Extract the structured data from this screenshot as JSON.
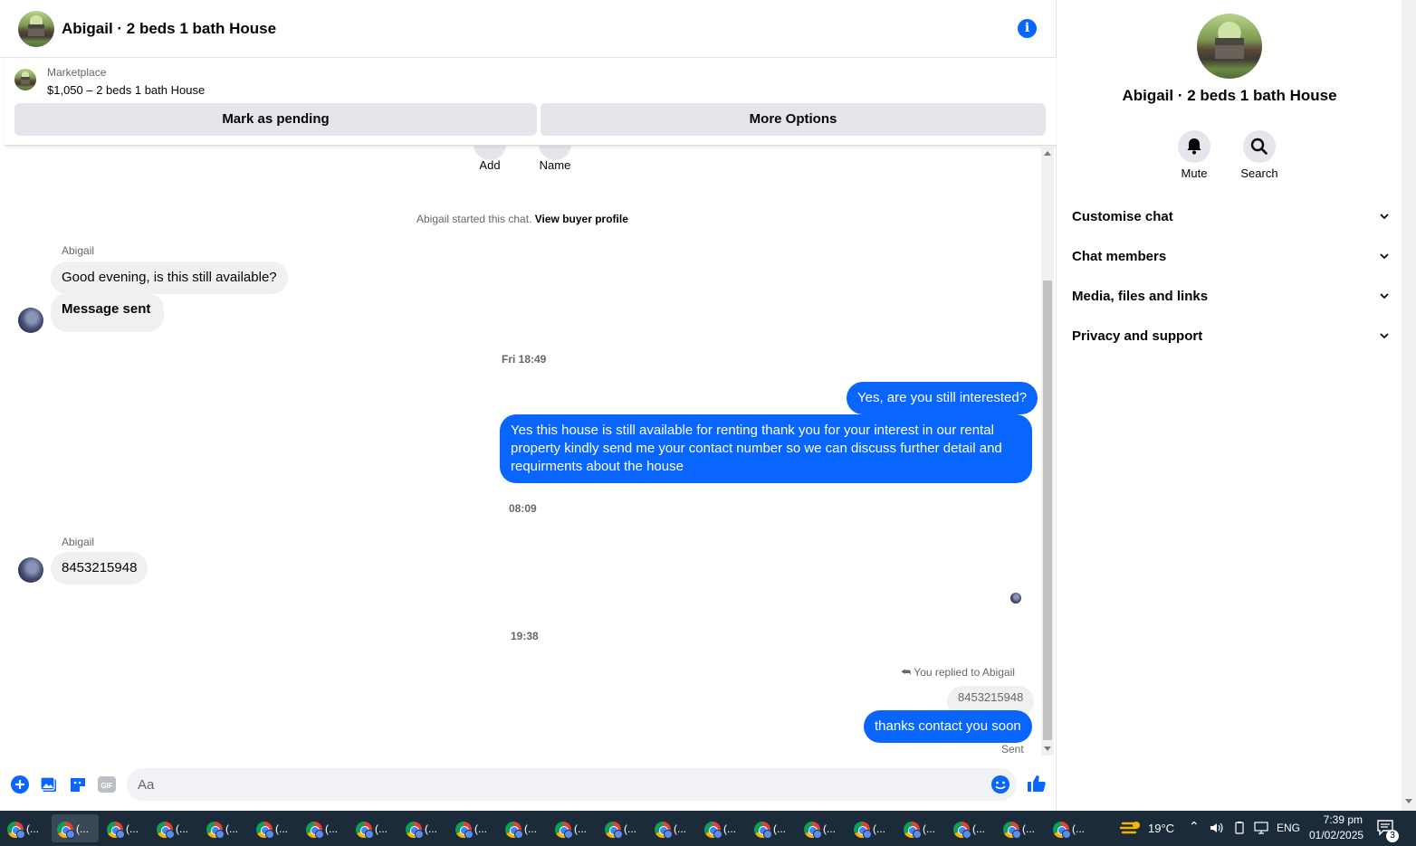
{
  "header": {
    "title": "Abigail · 2 beds 1 bath House",
    "info_icon": "i"
  },
  "listing": {
    "source": "Marketplace",
    "title": "$1,050 – 2 beds 1 bath House",
    "pending_label": "Mark as pending",
    "more_label": "More Options"
  },
  "chat": {
    "top_actions": [
      {
        "label": "Add",
        "icon": "add-person-icon"
      },
      {
        "label": "Name",
        "icon": "edit-name-icon"
      }
    ],
    "started_text": "Abigail started this chat.",
    "view_profile": "View buyer profile",
    "sender_name_1": "Abigail",
    "msg_in_1": "Good evening, is this still available?",
    "msg_in_2": "Message sent",
    "time_1": "Fri 18:49",
    "msg_out_1": "Yes, are you still interested?",
    "msg_out_2": "Yes this house is still available for renting thank you for your interest in our rental property kindly send me your contact number so we can discuss further detail and requirments about the house",
    "time_2": "08:09",
    "sender_name_2": "Abigail",
    "msg_in_3": "8453215948",
    "time_3": "19:38",
    "replied_to": "You replied to Abigail",
    "quoted": "8453215948",
    "msg_out_3": "thanks contact you soon",
    "status": "Sent"
  },
  "composer": {
    "placeholder": "Aa",
    "icons": [
      "plus-icon",
      "photo-icon",
      "sticker-icon",
      "gif-icon",
      "emoji-icon",
      "thumbs-up-icon"
    ],
    "gif_label": "GIF"
  },
  "right_panel": {
    "title": "Abigail · 2 beds 1 bath House",
    "mute_label": "Mute",
    "search_label": "Search",
    "sections": [
      "Customise chat",
      "Chat members",
      "Media, files and links",
      "Privacy and support"
    ]
  },
  "taskbar": {
    "app_label": "(...",
    "app_count": 22,
    "temperature": "19°C",
    "language": "ENG",
    "time": "7:39 pm",
    "date": "01/02/2025",
    "notifications": "3"
  },
  "colors": {
    "accent": "#0866ff",
    "bubble_in": "#f0f0f0",
    "secondary_text": "#65676b",
    "taskbar": "#1c2b3a"
  }
}
